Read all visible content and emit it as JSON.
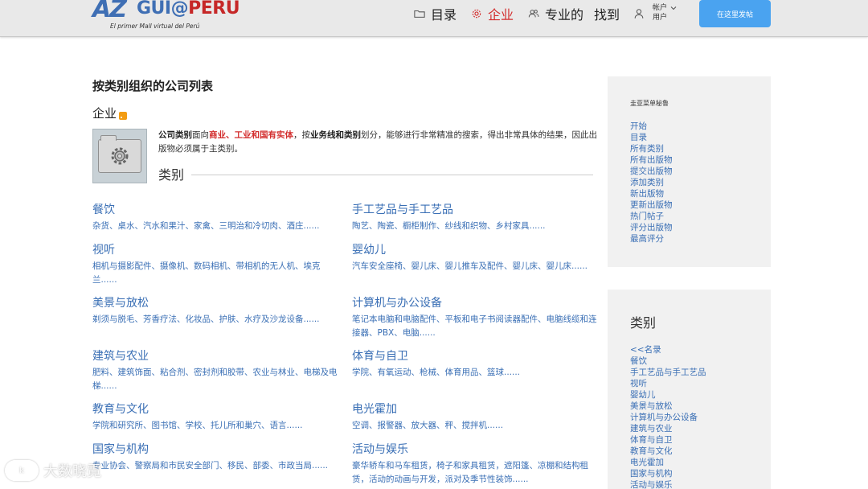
{
  "header": {
    "logo": {
      "az": "AZ",
      "main": "GUI@",
      "peru": "PERU",
      "tagline": "El primer Mall virtual del Perú"
    },
    "nav": [
      {
        "label": "目录",
        "icon": "folder-icon"
      },
      {
        "label": "企业",
        "icon": "gear-icon",
        "active": true
      },
      {
        "label": "专业的",
        "icon": "users-icon"
      },
      {
        "label": "找到",
        "icon": ""
      }
    ],
    "account": {
      "label": "帐户",
      "sub": "用户",
      "icon": "user-icon"
    },
    "post_button": "在这里发帖",
    "accent_color": "#4aa3f0",
    "active_color": "#d32f2f"
  },
  "main": {
    "page_title": "按类别组织的公司列表",
    "section_title": "企业",
    "intro": {
      "p1": "公司类别",
      "p2": "面向",
      "p3": "商业、工业和国有实体",
      "p4": "，按",
      "p5": "业务线和类别",
      "p6": "划分，能够进行非常精准的搜索，得出非常具体的结果，因此出版物必须属于主类别。"
    },
    "categories_header": "类别",
    "categories": [
      {
        "title": "餐饮",
        "desc": "杂货、桌水、汽水和果汁、家禽、三明治和冷切肉、酒庄......"
      },
      {
        "title": "手工艺品与手工艺品",
        "desc": "陶艺、陶瓷、橱柜制作、纱线和织物、乡村家具......"
      },
      {
        "title": "视听",
        "desc": "相机与摄影配件、摄像机、数码相机、带相机的无人机、埃克兰......"
      },
      {
        "title": "婴幼儿",
        "desc": "汽车安全座椅、婴儿床、婴儿推车及配件、婴儿床、婴儿床......"
      },
      {
        "title": "美景与放松",
        "desc": "剃须与脱毛、芳香疗法、化妆品、护肤、水疗及沙龙设备......"
      },
      {
        "title": "计算机与办公设备",
        "desc": "笔记本电脑和电脑配件、平板和电子书阅读器配件、电脑线缆和连接器、PBX、电脑......"
      },
      {
        "title": "建筑与农业",
        "desc": "肥料、建筑饰面、粘合剂、密封剂和胶带、农业与林业、电梯及电梯......"
      },
      {
        "title": "体育与自卫",
        "desc": "学院、有氧运动、枪械、体育用品、篮球......"
      },
      {
        "title": "教育与文化",
        "desc": "学院和研究所、图书馆、学校、托儿所和巢穴、语言......"
      },
      {
        "title": "电光霍加",
        "desc": "空调、报警器、放大器、秤、搅拌机......"
      },
      {
        "title": "国家与机构",
        "desc": "专业协会、警察局和市民安全部门、移民、部委、市政当局......"
      },
      {
        "title": "活动与娱乐",
        "desc": "豪华轿车和马车租赁，椅子和家具租赁，遮阳篷、凉棚和结构租赁，活动的动画与开发，派对及季节性装饰......"
      }
    ]
  },
  "sidebar": {
    "menu_heading": "圭亚菜单秘鲁",
    "menu_links": [
      "开始",
      "目录",
      "所有类别",
      "所有出版物",
      "提交出版物",
      "添加类别",
      "新出版物",
      "更新出版物",
      "热门帖子",
      "评分出版物",
      "最高评分"
    ],
    "categories_heading": "类别",
    "category_links": [
      "<<名录",
      "餐饮",
      "手工艺品与手工艺品",
      "视听",
      "婴幼儿",
      "美景与放松",
      "计算机与办公设备",
      "建筑与农业",
      "体育与自卫",
      "教育与文化",
      "电光霍加",
      "国家与机构",
      "活动与娱乐"
    ]
  },
  "watermark": {
    "logo": "k",
    "text": "大数晓霓"
  }
}
